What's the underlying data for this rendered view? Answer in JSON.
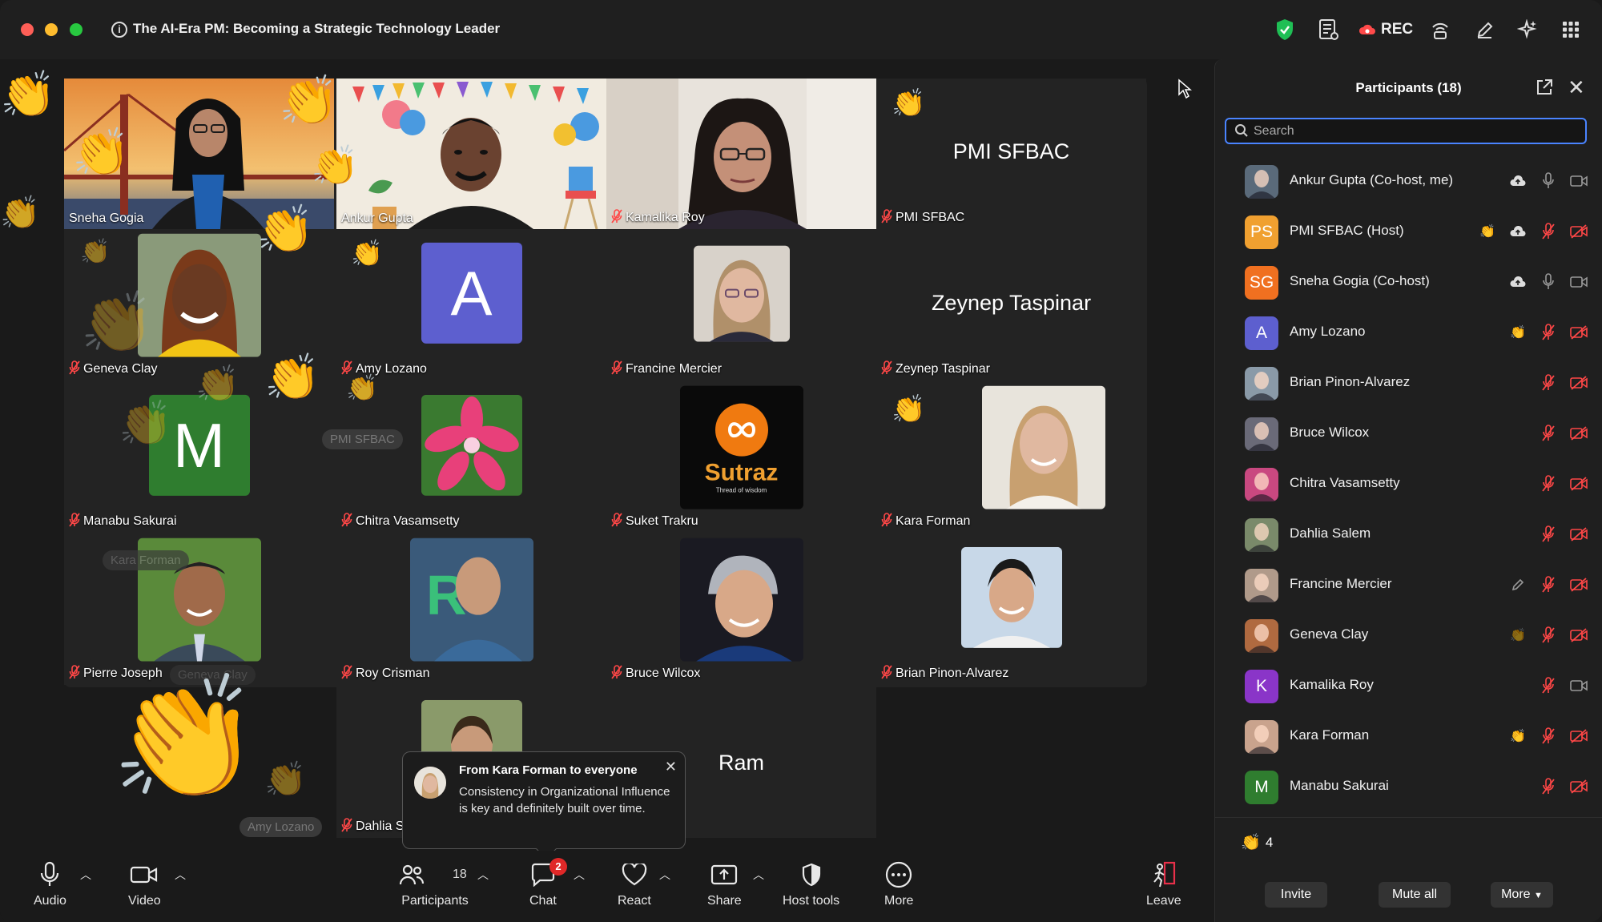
{
  "window": {
    "title": "The AI-Era PM: Becoming a Strategic Technology Leader",
    "rec_label": "REC"
  },
  "tiles": [
    {
      "name": "Sneha Gogia",
      "muted": false,
      "kind": "video"
    },
    {
      "name": "Ankur Gupta",
      "muted": false,
      "kind": "video"
    },
    {
      "name": "Kamalika Roy",
      "muted": true,
      "kind": "video"
    },
    {
      "name": "PMI SFBAC",
      "muted": true,
      "kind": "text",
      "big_name": "PMI SFBAC"
    },
    {
      "name": "Geneva Clay",
      "muted": true,
      "kind": "photo"
    },
    {
      "name": "Amy Lozano",
      "muted": true,
      "kind": "letter",
      "letter": "A"
    },
    {
      "name": "Francine Mercier",
      "muted": true,
      "kind": "photo"
    },
    {
      "name": "Zeynep Taspinar",
      "muted": true,
      "kind": "text",
      "big_name": "Zeynep Taspinar"
    },
    {
      "name": "Manabu Sakurai",
      "muted": true,
      "kind": "letter",
      "letter": "M"
    },
    {
      "name": "Chitra Vasamsetty",
      "muted": true,
      "kind": "photo"
    },
    {
      "name": "Suket Trakru",
      "muted": true,
      "kind": "logo",
      "logo_text": "Sutraz",
      "logo_sub": "Thread of wisdom"
    },
    {
      "name": "Kara Forman",
      "muted": true,
      "kind": "photo"
    },
    {
      "name": "Pierre Joseph",
      "muted": true,
      "kind": "photo"
    },
    {
      "name": "Roy Crisman",
      "muted": true,
      "kind": "photo"
    },
    {
      "name": "Bruce Wilcox",
      "muted": true,
      "kind": "photo"
    },
    {
      "name": "Brian Pinon-Alvarez",
      "muted": true,
      "kind": "photo"
    },
    {
      "name": "Dahlia S",
      "muted": true,
      "kind": "photo"
    },
    {
      "name": "Ram",
      "muted": false,
      "kind": "text",
      "big_name": "Ram"
    }
  ],
  "ghost_labels": [
    "PMI SFBAC",
    "Kara Forman",
    "Geneva Clay",
    "Amy Lozano"
  ],
  "chat_toast": {
    "from": "From Kara Forman to everyone",
    "message": "Consistency in Organizational Influence is key and definitely built over time."
  },
  "toolbar": {
    "audio": "Audio",
    "video": "Video",
    "participants": "Participants",
    "participants_count": "18",
    "chat": "Chat",
    "chat_badge": "2",
    "react": "React",
    "share": "Share",
    "host_tools": "Host tools",
    "more": "More",
    "leave": "Leave"
  },
  "panel": {
    "title": "Participants (18)",
    "search_placeholder": "Search",
    "participants": [
      {
        "name": "Ankur Gupta (Co-host, me)",
        "initials": "",
        "color": "#5a6a7a"
      },
      {
        "name": "PMI SFBAC (Host)",
        "initials": "PS",
        "color": "#f0a030"
      },
      {
        "name": "Sneha Gogia (Co-host)",
        "initials": "SG",
        "color": "#f07020"
      },
      {
        "name": "Amy Lozano",
        "initials": "A",
        "color": "#5d5fcf"
      },
      {
        "name": "Brian Pinon-Alvarez",
        "initials": "",
        "color": "#8a9aa8"
      },
      {
        "name": "Bruce Wilcox",
        "initials": "",
        "color": "#6a6a78"
      },
      {
        "name": "Chitra Vasamsetty",
        "initials": "",
        "color": "#c94880"
      },
      {
        "name": "Dahlia Salem",
        "initials": "",
        "color": "#7a8a6a"
      },
      {
        "name": "Francine Mercier",
        "initials": "",
        "color": "#b09a8a"
      },
      {
        "name": "Geneva Clay",
        "initials": "",
        "color": "#b06a40"
      },
      {
        "name": "Kamalika Roy",
        "initials": "K",
        "color": "#8a35c8"
      },
      {
        "name": "Kara Forman",
        "initials": "",
        "color": "#c9a38d"
      },
      {
        "name": "Manabu Sakurai",
        "initials": "M",
        "color": "#2f7d2f"
      }
    ],
    "raised_hands": "4",
    "invite": "Invite",
    "mute_all": "Mute all",
    "more": "More"
  },
  "colors": {
    "accent_blue": "#4a84ff",
    "muted_red": "#ff4747",
    "active_green": "#3ecb5b",
    "badge_red": "#e02828"
  }
}
